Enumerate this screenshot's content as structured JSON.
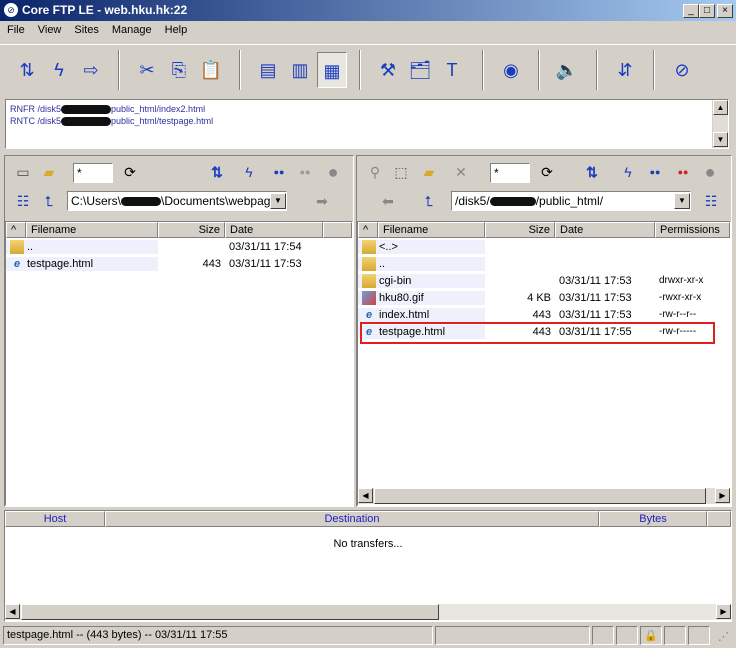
{
  "window": {
    "title": "Core FTP LE - web.hku.hk:22",
    "controls": [
      "_",
      "□",
      "×"
    ]
  },
  "menu": [
    "File",
    "View",
    "Sites",
    "Manage",
    "Help"
  ],
  "toolbar": [
    {
      "icon": "connect-icon",
      "glyph": "⇅"
    },
    {
      "icon": "quick-connect-icon",
      "glyph": "ϟ"
    },
    {
      "icon": "disconnect-icon",
      "glyph": "⇨"
    },
    {
      "icon": "cut-icon",
      "glyph": "✂"
    },
    {
      "icon": "copy-icon",
      "glyph": "⎘"
    },
    {
      "icon": "paste-icon",
      "glyph": "📋"
    },
    {
      "icon": "view-text-icon",
      "glyph": "▤"
    },
    {
      "icon": "binary-mode-icon",
      "glyph": "▥"
    },
    {
      "icon": "auto-mode-icon",
      "glyph": "▦"
    },
    {
      "icon": "settings-icon",
      "glyph": "⚒"
    },
    {
      "icon": "site-manager-icon",
      "glyph": "🗂"
    },
    {
      "icon": "edit-icon",
      "glyph": "T"
    },
    {
      "icon": "view-icon",
      "glyph": "◉"
    },
    {
      "icon": "sound-icon",
      "glyph": "🔈"
    },
    {
      "icon": "sync-icon",
      "glyph": "⇵"
    },
    {
      "icon": "about-icon",
      "glyph": "⊘"
    }
  ],
  "log": [
    "RNFR /disk5",
    "public_html/index2.html",
    "RNTC /disk5",
    "public_html/testpage.html"
  ],
  "local": {
    "filter": "*",
    "path_prefix": "C:\\Users\\",
    "path_suffix": "\\Documents\\webpages",
    "columns": [
      "^",
      "Filename",
      "Size",
      "Date"
    ],
    "rows": [
      {
        "type": "folder",
        "name": "..",
        "size": "",
        "date": "03/31/11  17:54"
      },
      {
        "type": "html",
        "name": "testpage.html",
        "size": "443",
        "date": "03/31/11  17:53"
      }
    ]
  },
  "remote": {
    "filter": "*",
    "path_prefix": "/disk5/",
    "path_suffix": "/public_html/",
    "columns": [
      "^",
      "Filename",
      "Size",
      "Date",
      "Permissions"
    ],
    "rows": [
      {
        "type": "folder",
        "name": "<..>",
        "size": "",
        "date": "",
        "perm": ""
      },
      {
        "type": "folder",
        "name": "..",
        "size": "",
        "date": "",
        "perm": ""
      },
      {
        "type": "folder",
        "name": "cgi-bin",
        "size": "",
        "date": "03/31/11  17:53",
        "perm": "drwxr-xr-x"
      },
      {
        "type": "gif",
        "name": "hku80.gif",
        "size": "4 KB",
        "date": "03/31/11  17:53",
        "perm": "-rwxr-xr-x"
      },
      {
        "type": "html",
        "name": "index.html",
        "size": "443",
        "date": "03/31/11  17:53",
        "perm": "-rw-r--r--"
      },
      {
        "type": "html",
        "name": "testpage.html",
        "size": "443",
        "date": "03/31/11  17:55",
        "perm": "-rw-r-----",
        "highlighted": true
      }
    ],
    "highlight_color": "#e02020"
  },
  "transfers": {
    "columns": [
      "Host",
      "Destination",
      "Bytes"
    ],
    "empty_text": "No transfers...",
    "header_color": "#2020c0"
  },
  "status": {
    "text": "testpage.html -- (443 bytes) -- 03/31/11  17:55"
  }
}
